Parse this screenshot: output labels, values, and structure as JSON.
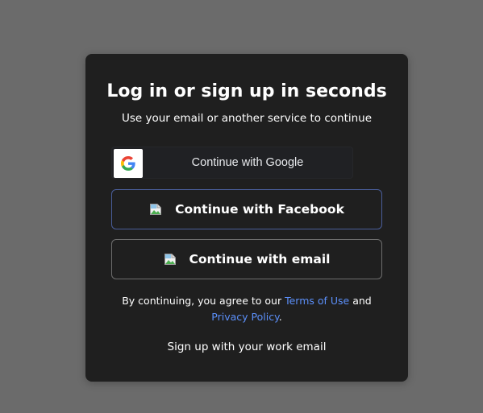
{
  "modal": {
    "title": "Log in or sign up in seconds",
    "subtitle": "Use your email or another service to continue"
  },
  "buttons": {
    "google_label": "Continue with Google",
    "google_icon": "google-g-icon",
    "facebook_label": "Continue with Facebook",
    "facebook_icon": "broken-image-icon",
    "email_label": "Continue with email",
    "email_icon": "broken-image-icon"
  },
  "legal": {
    "prefix": "By continuing, you agree to our ",
    "terms_link": "Terms of Use",
    "conjunction": " and ",
    "privacy_link": "Privacy Policy",
    "suffix": "."
  },
  "footer": {
    "work_email": "Sign up with your work email"
  },
  "colors": {
    "overlay_background": "#6b6b6b",
    "modal_background": "#1f1f1f",
    "link": "#5b8ff9",
    "facebook_border": "#4a5e9a",
    "email_border": "#6e6e6e"
  }
}
